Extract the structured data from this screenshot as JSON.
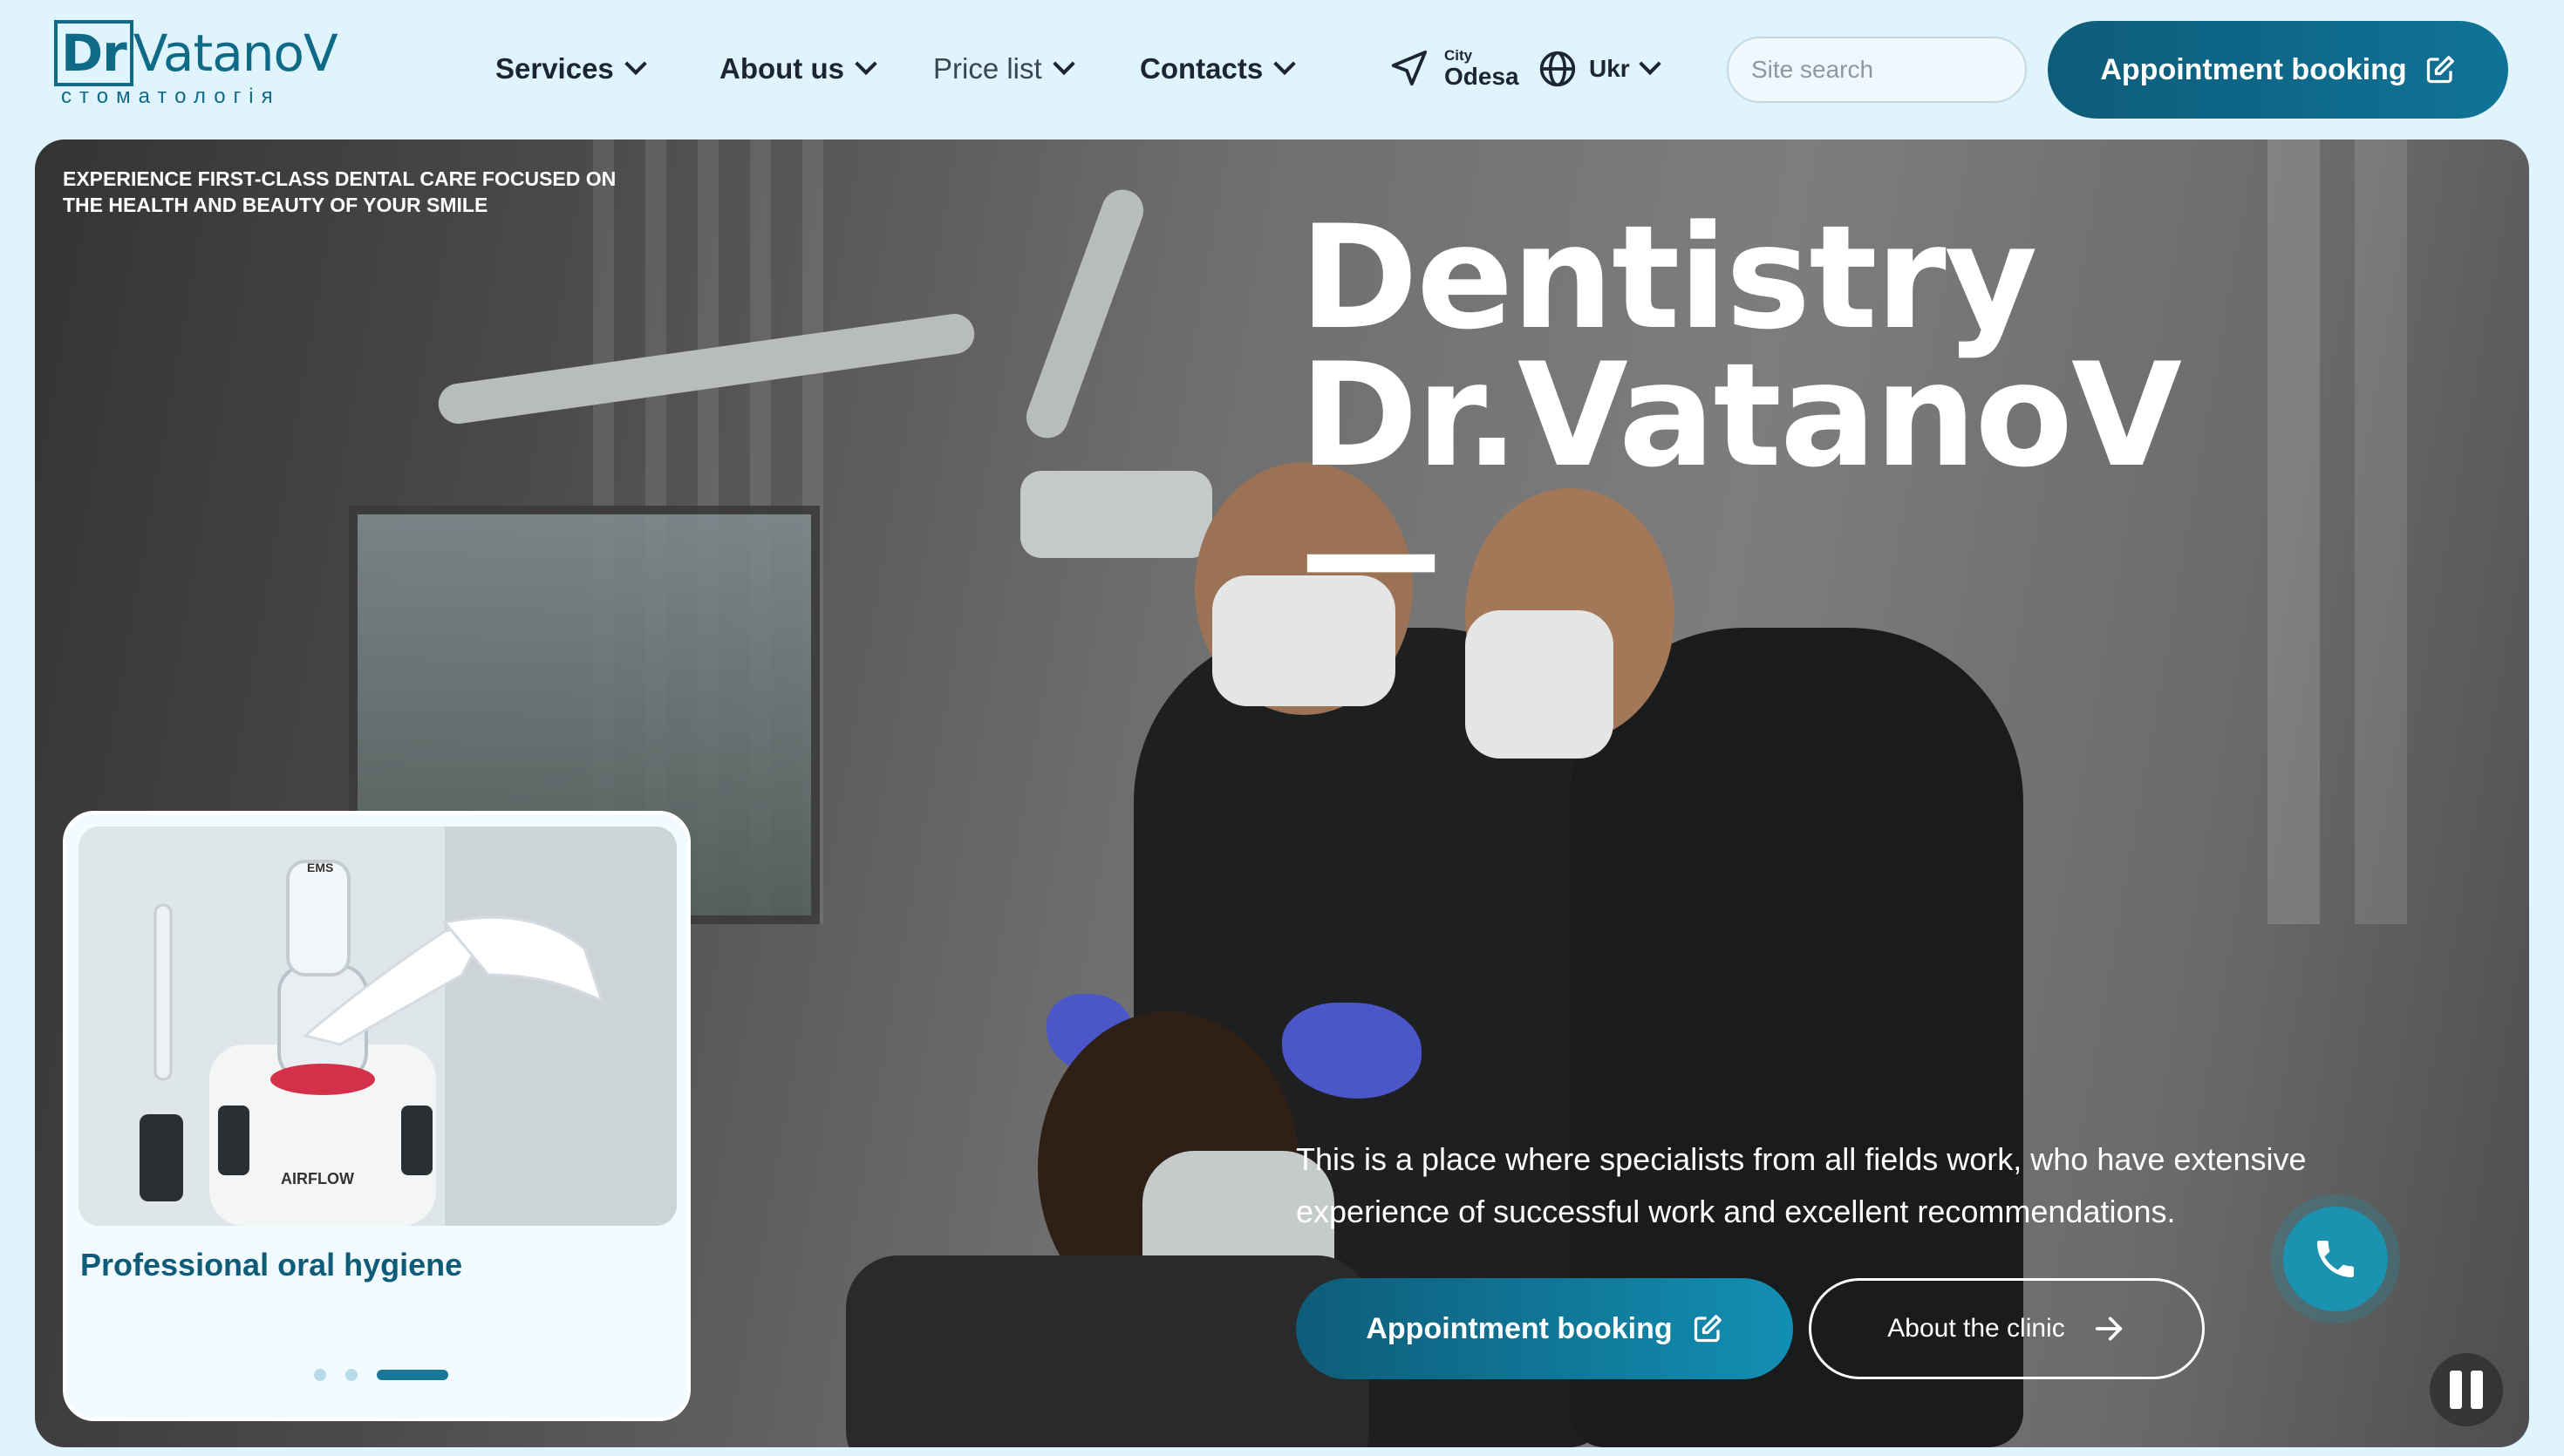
{
  "header": {
    "logo": {
      "brand_prefix": "Dr",
      "brand_rest": "VatanoV",
      "subtitle": "стоматологія"
    },
    "nav": [
      {
        "label": "Services"
      },
      {
        "label": "About us"
      },
      {
        "label": "Price list"
      },
      {
        "label": "Contacts"
      }
    ],
    "city": {
      "label": "City",
      "value": "Odesa"
    },
    "language": "Ukr",
    "search": {
      "placeholder": "Site search",
      "value": ""
    },
    "booking_button": "Appointment booking"
  },
  "hero": {
    "tagline": "Experience first-class dental care focused on the health and beauty of your smile",
    "title_line1": "Dentistry",
    "title_line2": "Dr.VatanoV —",
    "description": "This is a place where specialists from all fields work, who have extensive experience of successful work and excellent recommendations.",
    "booking_button": "Appointment booking",
    "about_button": "About the clinic"
  },
  "slide_card": {
    "title": "Professional oral hygiene",
    "image_labels": {
      "device_brand": "AIRFLOW",
      "cap_brand": "EMS"
    },
    "slides_total": 3,
    "active_slide": 3
  },
  "colors": {
    "page_background": "#dff4fd",
    "brand_dark": "#0e5c79",
    "brand_accent": "#1b92b0",
    "text_dark": "#1d2530"
  },
  "icons": {
    "nav_dropdown": "chevron-down-icon",
    "city": "location-arrow-icon",
    "language": "globe-icon",
    "search": "search-icon",
    "booking": "edit-icon",
    "about": "arrow-right-icon",
    "call": "phone-icon",
    "pause": "pause-icon"
  }
}
